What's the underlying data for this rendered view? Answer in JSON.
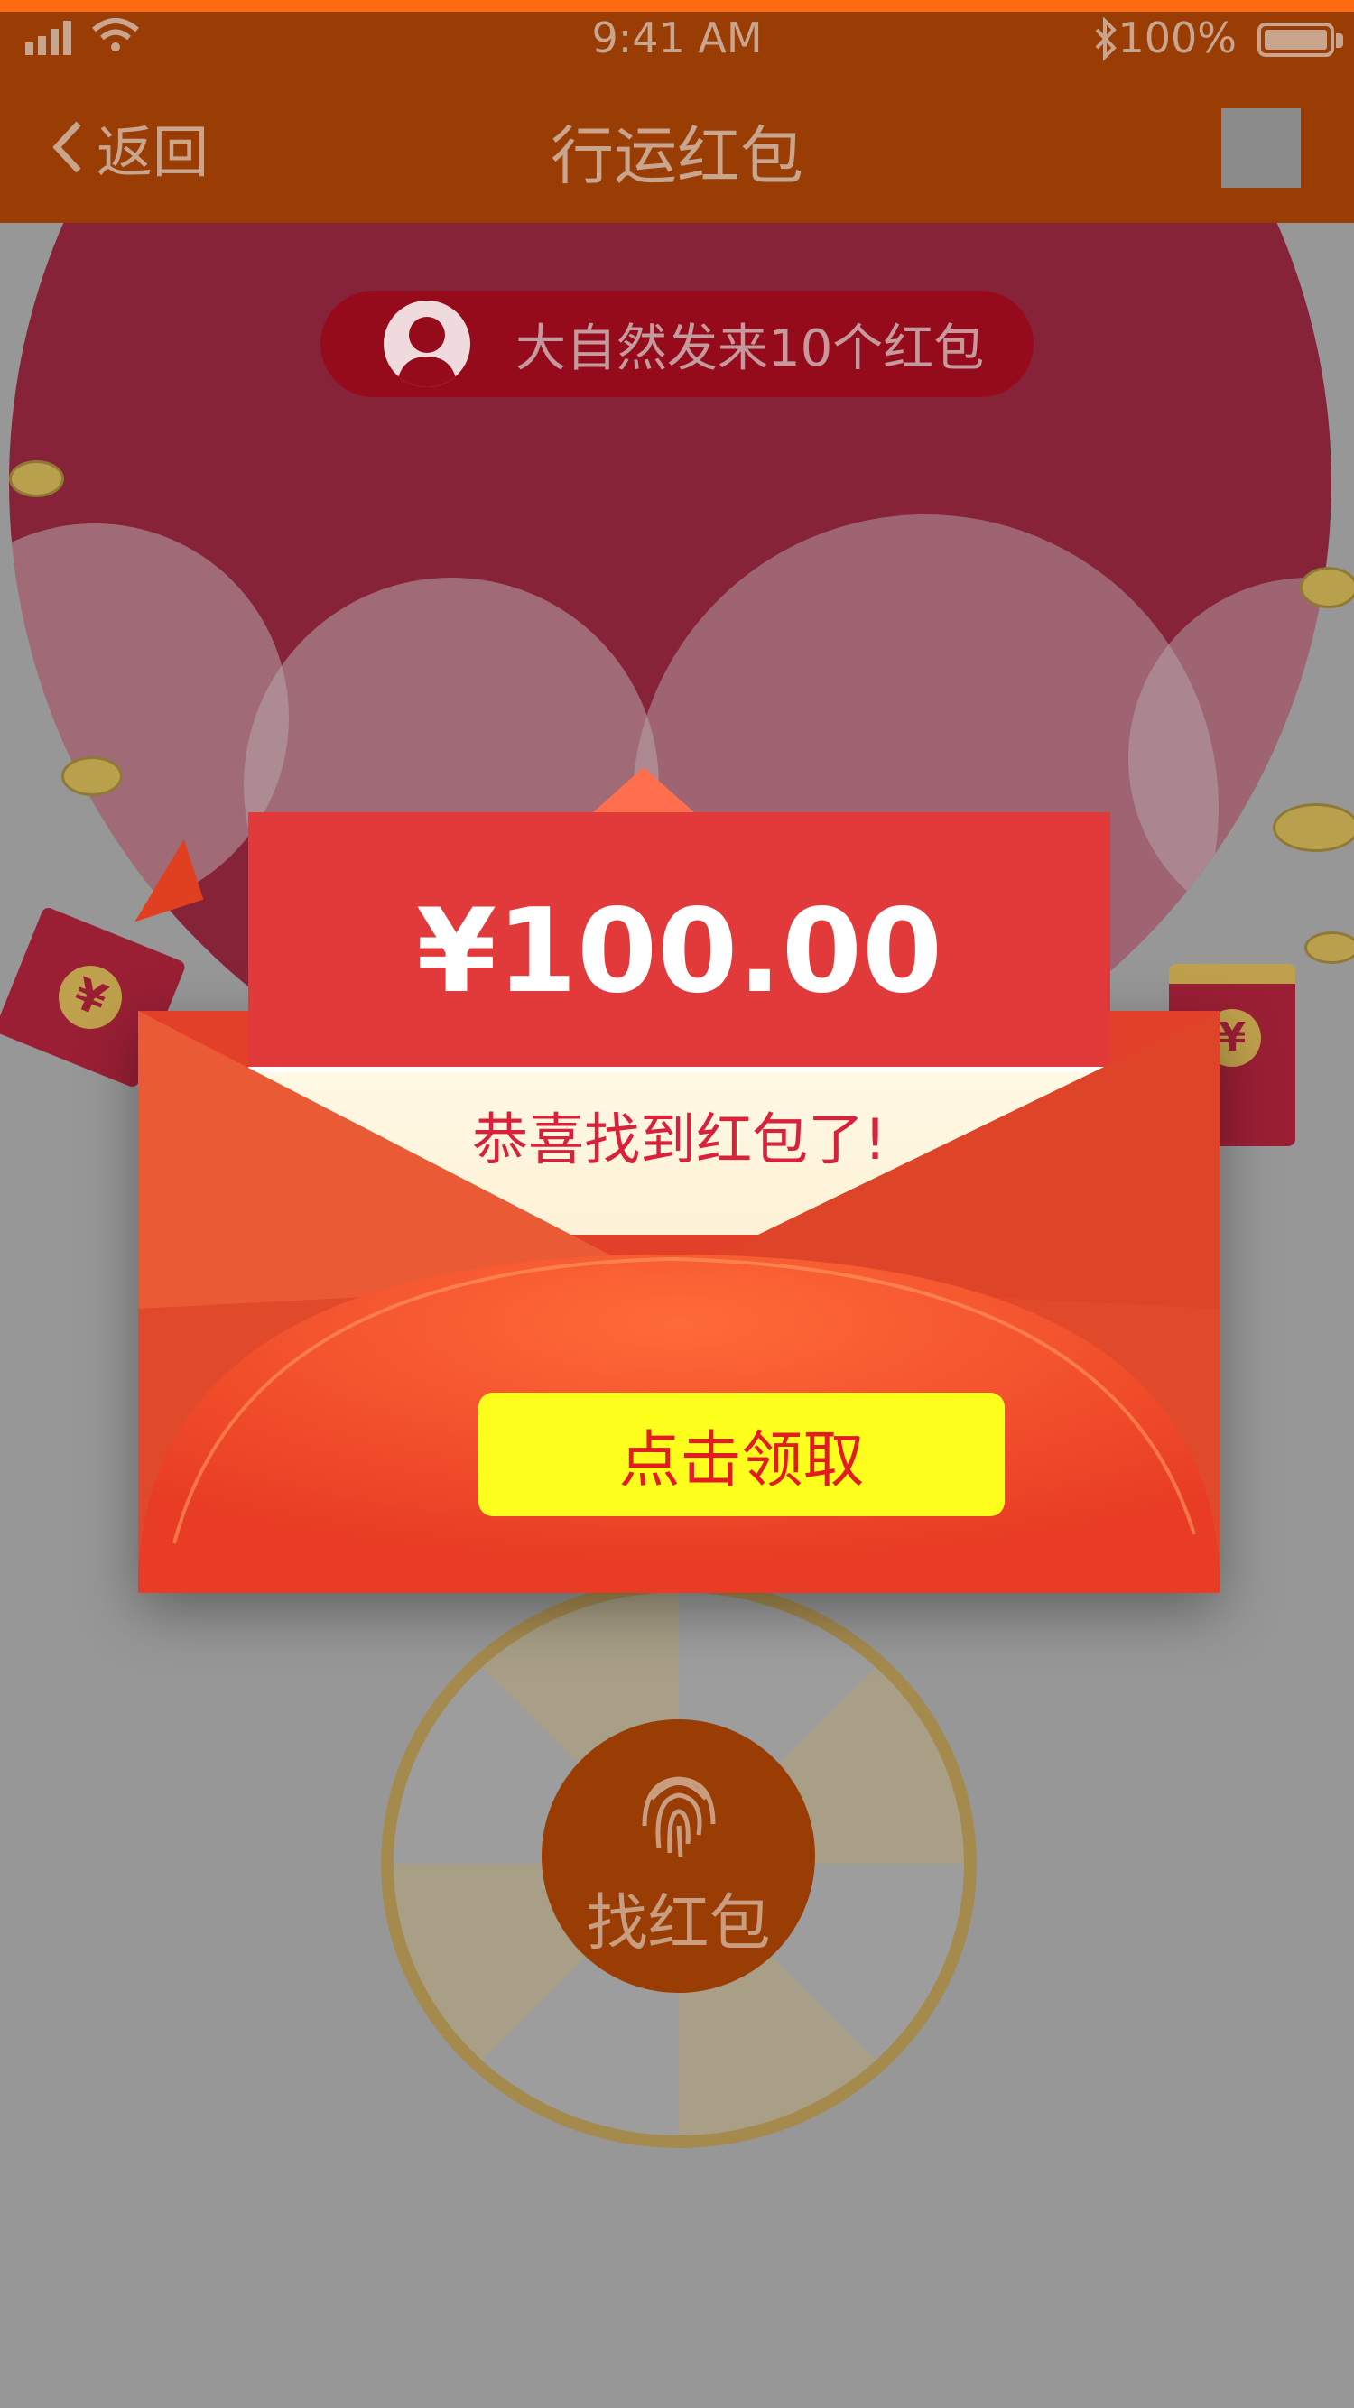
{
  "status_bar": {
    "time": "9:41 AM",
    "battery": "100%"
  },
  "nav": {
    "back_label": "返回",
    "title": "行运红包"
  },
  "sender_message": "大自然发来10个红包",
  "envelope": {
    "amount": "¥100.00",
    "message": "恭喜找到红包了!",
    "claim_label": "点击领取"
  },
  "find_button_label": "找红包",
  "colors": {
    "nav_bg": "#9a3d05",
    "accent_orange": "#ff6b12",
    "envelope_red": "#e3402a",
    "claim_yellow": "#ffff1e"
  }
}
